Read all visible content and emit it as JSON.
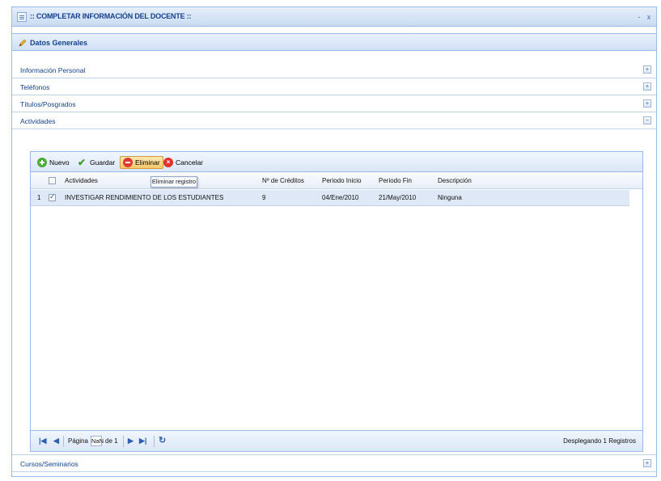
{
  "window": {
    "title": ":: COMPLETAR INFORMACIÓN DEL DOCENTE ::",
    "controls": [
      "-",
      "x"
    ]
  },
  "section": {
    "title": "Datos Generales"
  },
  "accordion": {
    "items": [
      {
        "label": "Información Personal",
        "toggle": "+"
      },
      {
        "label": "Teléfonos",
        "toggle": "+"
      },
      {
        "label": "Títulos/Posgrados",
        "toggle": "+"
      },
      {
        "label": "Actividades",
        "toggle": "−"
      }
    ],
    "bottom_item": {
      "label": "Cursos/Seminarios",
      "toggle": "+"
    }
  },
  "toolbar": {
    "new_label": "Nuevo",
    "save_label": "Guardar",
    "delete_label": "Eliminar",
    "cancel_label": "Cancelar",
    "delete_tooltip": "Eliminar registro"
  },
  "grid": {
    "columns": [
      "Actividades",
      "Nº de Créditos",
      "Periodo Inicio",
      "Periodo Fin",
      "Descripción"
    ],
    "rows": [
      {
        "index": "1",
        "checked": true,
        "cells": [
          "INVESTIGAR RENDIMIENTO DE LOS ESTUDIANTES",
          "9",
          "04/Ene/2010",
          "21/May/2010",
          "Ninguna"
        ]
      }
    ]
  },
  "pager": {
    "page_label": "Página",
    "page_value": "NaN",
    "of_label": "de 1",
    "display_text": "Desplegando 1 Registros"
  },
  "colors": {
    "accent": "#15428b",
    "border": "#99bbe8",
    "row_selected": "#dfe8f6"
  }
}
